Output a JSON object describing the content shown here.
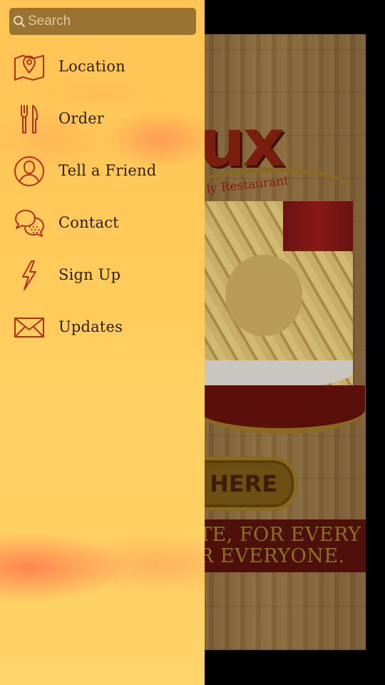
{
  "search": {
    "placeholder": "Search"
  },
  "menu": {
    "items": [
      {
        "label": "Location",
        "icon": "map-pin-icon"
      },
      {
        "label": "Order",
        "icon": "fork-knife-icon"
      },
      {
        "label": "Tell a Friend",
        "icon": "user-circle-icon"
      },
      {
        "label": "Contact",
        "icon": "speech-bubbles-icon"
      },
      {
        "label": "Sign Up",
        "icon": "lightning-icon"
      },
      {
        "label": "Updates",
        "icon": "envelope-icon"
      }
    ]
  },
  "background_app": {
    "logo_text": "ux",
    "tagline": "ly Restaurant",
    "order_button_label": "HERE",
    "banner_line_1": "TE, FOR EVERY",
    "banner_line_2": "R EVERYONE."
  },
  "colors": {
    "icon_stroke": "#b5301c",
    "menu_text": "#2a1e12",
    "search_bg": "#7d5c28"
  }
}
